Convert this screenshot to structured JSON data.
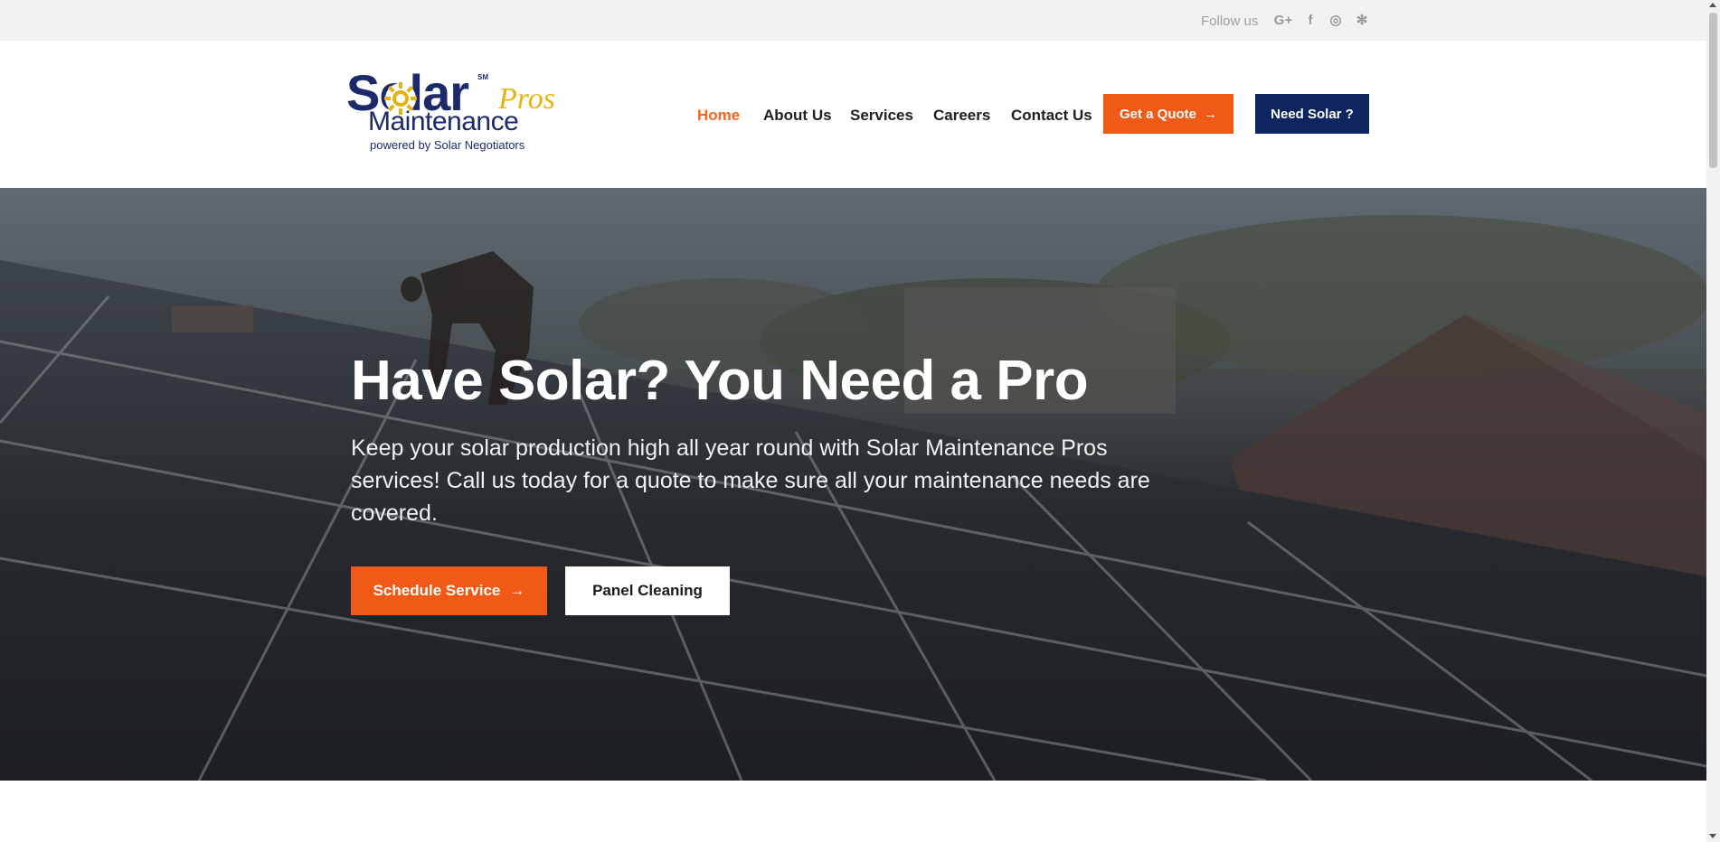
{
  "topbar": {
    "follow_label": "Follow us",
    "social": [
      {
        "name": "google-plus-icon",
        "glyph": "G+"
      },
      {
        "name": "facebook-icon",
        "glyph": "f"
      },
      {
        "name": "instagram-icon",
        "glyph": "◎"
      },
      {
        "name": "yelp-icon",
        "glyph": "✻"
      }
    ]
  },
  "logo": {
    "word_solar": "Solar",
    "service_mark": "SM",
    "word_pros": "Pros",
    "word_maintenance": "Maintenance",
    "tagline": "powered by Solar Negotiators"
  },
  "nav": {
    "items": [
      {
        "label": "Home",
        "active": true
      },
      {
        "label": "About Us",
        "active": false
      },
      {
        "label": "Services",
        "active": false
      },
      {
        "label": "Careers",
        "active": false
      },
      {
        "label": "Contact Us",
        "active": false
      }
    ],
    "quote_button": "Get a Quote",
    "quote_arrow": "→",
    "need_solar_button": "Need Solar ?"
  },
  "hero": {
    "title": "Have Solar? You Need a Pro",
    "description": "Keep your solar production high all year round with Solar Maintenance Pros services! Call us today for a quote to make sure all your maintenance needs are covered.",
    "schedule_button": "Schedule Service",
    "schedule_arrow": "→",
    "panel_button": "Panel Cleaning"
  },
  "colors": {
    "accent_orange": "#f15a16",
    "navy": "#0f2560",
    "active_nav": "#f26522"
  }
}
